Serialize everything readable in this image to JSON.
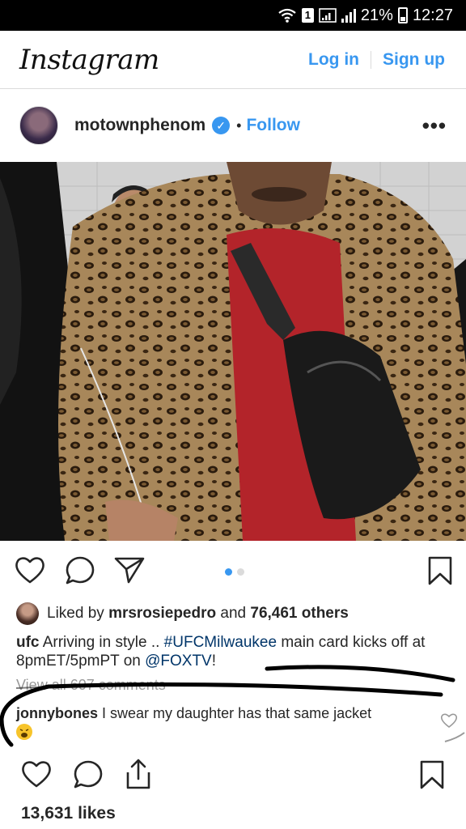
{
  "status_bar": {
    "sim_badge": "1",
    "battery_percent": "21%",
    "time": "12:27"
  },
  "header": {
    "logo": "Instagram",
    "login_label": "Log in",
    "signup_label": "Sign up"
  },
  "post": {
    "username": "motownphenom",
    "verified_icon": "verified-badge-icon",
    "follow_label": "Follow",
    "more_label": "•••",
    "carousel_pages": 2,
    "carousel_active": 1
  },
  "likes_line": {
    "prefix": "Liked by",
    "liker": "mrsrosiepedro",
    "middle": "and",
    "others": "76,461 others"
  },
  "caption": {
    "author": "ufc",
    "text_1": " Arriving in style .. ",
    "hashtag": "#UFCMilwaukee",
    "text_2": " main card kicks off at 8pmET/5pmPT on ",
    "mention": "@FOXTV",
    "text_3": "!"
  },
  "view_all_comments": "View all 607 comments",
  "comment": {
    "author": "jonnybones",
    "text": " I swear my daughter has that same jacket"
  },
  "likes_count": "13,631 likes",
  "colors": {
    "link_blue": "#3897f0",
    "status_black": "#000000",
    "marker_black": "#000000"
  }
}
